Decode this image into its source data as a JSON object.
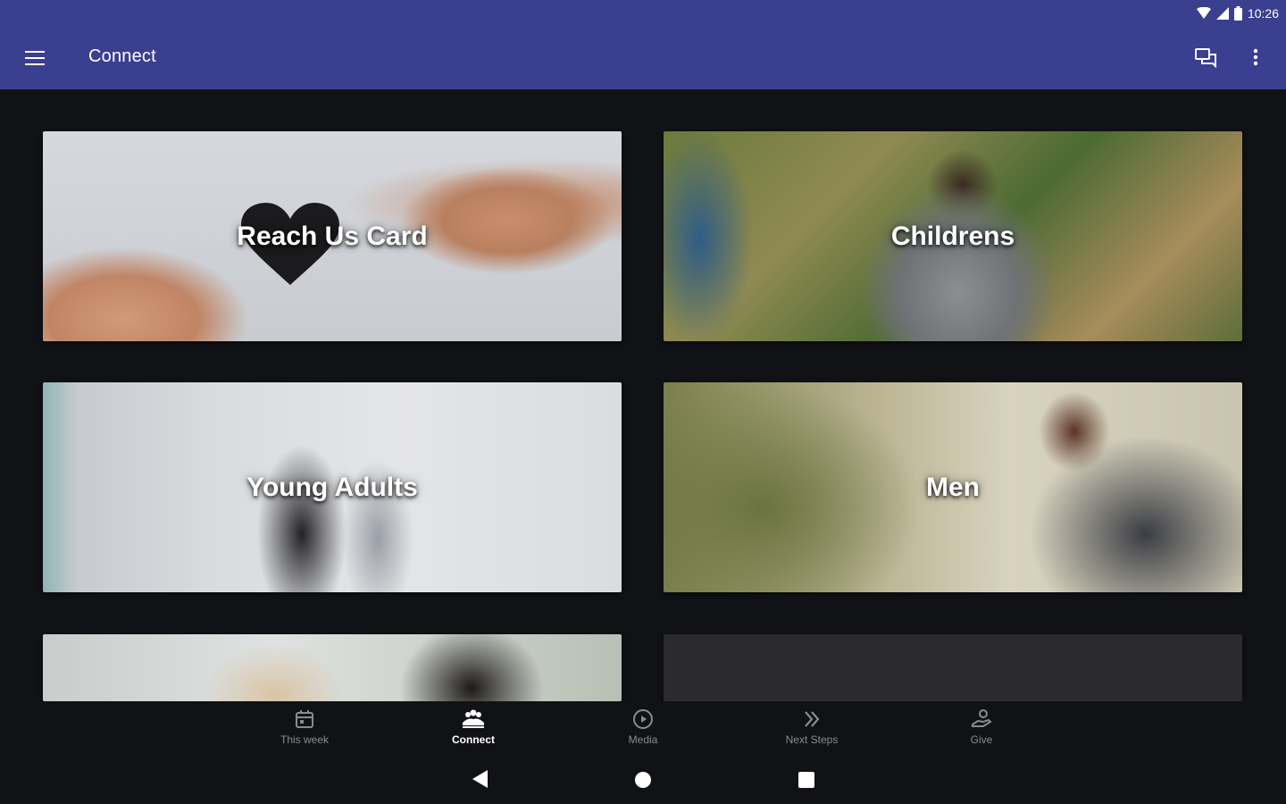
{
  "status_bar": {
    "time": "10:26"
  },
  "app_bar": {
    "title": "Connect",
    "menu_icon": "menu-icon",
    "chat_icon": "chat-icon",
    "more_icon": "more-vert-icon"
  },
  "tiles": [
    {
      "label": "Reach Us Card"
    },
    {
      "label": "Childrens"
    },
    {
      "label": "Young Adults"
    },
    {
      "label": "Men"
    },
    {
      "label": ""
    },
    {
      "label": ""
    }
  ],
  "bottom_nav": {
    "active": "Connect",
    "items": [
      {
        "label": "This week",
        "icon": "calendar-icon"
      },
      {
        "label": "Connect",
        "icon": "people-icon"
      },
      {
        "label": "Media",
        "icon": "play-circle-icon"
      },
      {
        "label": "Next Steps",
        "icon": "double-chevron-icon"
      },
      {
        "label": "Give",
        "icon": "give-hand-icon"
      }
    ]
  },
  "colors": {
    "app_bar": "#3a3f8f",
    "background": "#111216",
    "nav_inactive": "#8a8b90",
    "nav_active": "#ffffff"
  }
}
